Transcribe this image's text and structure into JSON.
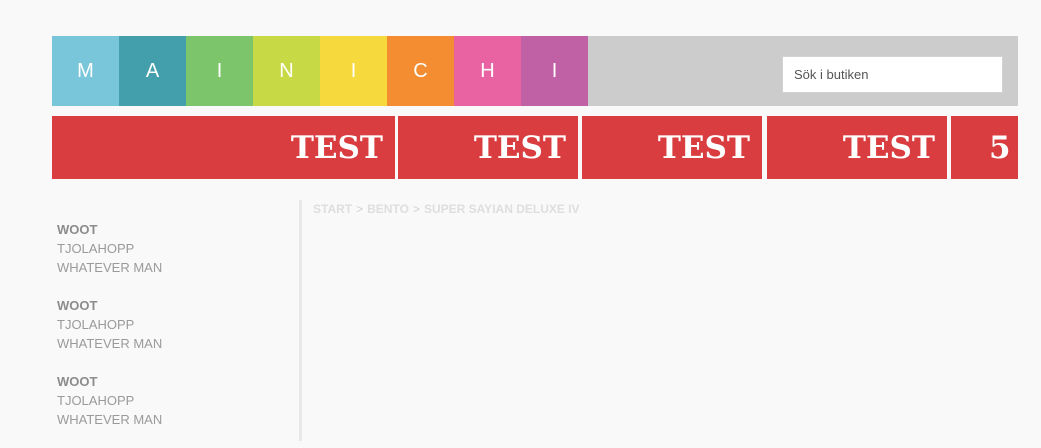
{
  "logo": {
    "letters": [
      "M",
      "A",
      "I",
      "N",
      "I",
      "C",
      "H",
      "I"
    ],
    "colors": [
      "#79c6da",
      "#449fac",
      "#7cc56a",
      "#c7da45",
      "#f6d93d",
      "#f48d32",
      "#e962a2",
      "#c061a6"
    ]
  },
  "search": {
    "placeholder": "Sök i butiken",
    "value": ""
  },
  "nav": {
    "items": [
      "TEST",
      "TEST",
      "TEST",
      "TEST",
      "5"
    ],
    "color": "#d93d3f"
  },
  "sidebar": {
    "groups": [
      {
        "heading": "WOOT",
        "links": [
          "TJOLAHOPP",
          "WHATEVER MAN"
        ]
      },
      {
        "heading": "WOOT",
        "links": [
          "TJOLAHOPP",
          "WHATEVER MAN"
        ]
      },
      {
        "heading": "WOOT",
        "links": [
          "TJOLAHOPP",
          "WHATEVER MAN"
        ]
      }
    ]
  },
  "breadcrumb": {
    "items": [
      "START",
      "BENTO",
      "SUPER SAYIAN DELUXE IV"
    ],
    "separator": ">"
  }
}
